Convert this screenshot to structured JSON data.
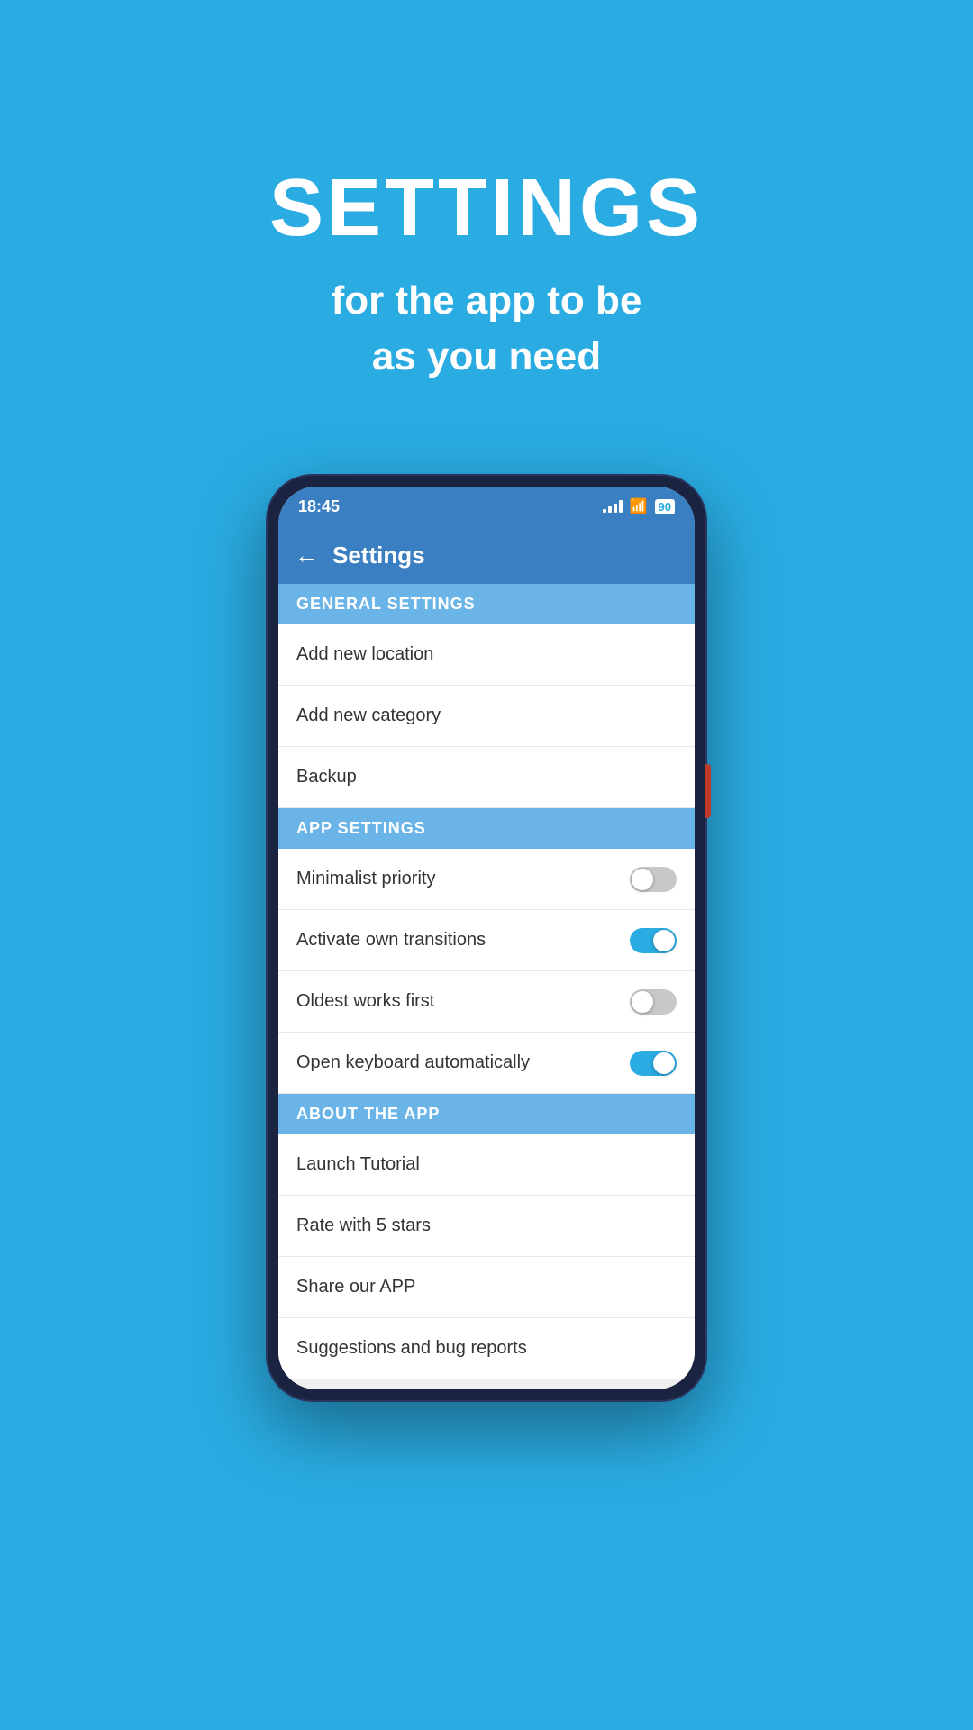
{
  "header": {
    "title": "SETTINGS",
    "subtitle_line1": "for the app to be",
    "subtitle_line2": "as you need"
  },
  "status_bar": {
    "time": "18:45",
    "battery": "90"
  },
  "app_bar": {
    "title": "Settings",
    "back_label": "←"
  },
  "sections": [
    {
      "id": "general",
      "header": "GENERAL SETTINGS",
      "items": [
        {
          "id": "add-location",
          "label": "Add new location",
          "has_toggle": false
        },
        {
          "id": "add-category",
          "label": "Add new category",
          "has_toggle": false
        },
        {
          "id": "backup",
          "label": "Backup",
          "has_toggle": false
        }
      ]
    },
    {
      "id": "app",
      "header": "APP SETTINGS",
      "items": [
        {
          "id": "minimalist-priority",
          "label": "Minimalist priority",
          "has_toggle": true,
          "toggle_on": false
        },
        {
          "id": "activate-transitions",
          "label": "Activate own transitions",
          "has_toggle": true,
          "toggle_on": true
        },
        {
          "id": "oldest-works-first",
          "label": "Oldest works first",
          "has_toggle": true,
          "toggle_on": false
        },
        {
          "id": "open-keyboard",
          "label": "Open keyboard automatically",
          "has_toggle": true,
          "toggle_on": true
        }
      ]
    },
    {
      "id": "about",
      "header": "ABOUT THE APP",
      "items": [
        {
          "id": "launch-tutorial",
          "label": "Launch Tutorial",
          "has_toggle": false
        },
        {
          "id": "rate-stars",
          "label": "Rate with 5 stars",
          "has_toggle": false
        },
        {
          "id": "share-app",
          "label": "Share our APP",
          "has_toggle": false
        },
        {
          "id": "suggestions",
          "label": "Suggestions and bug reports",
          "has_toggle": false
        }
      ]
    }
  ]
}
